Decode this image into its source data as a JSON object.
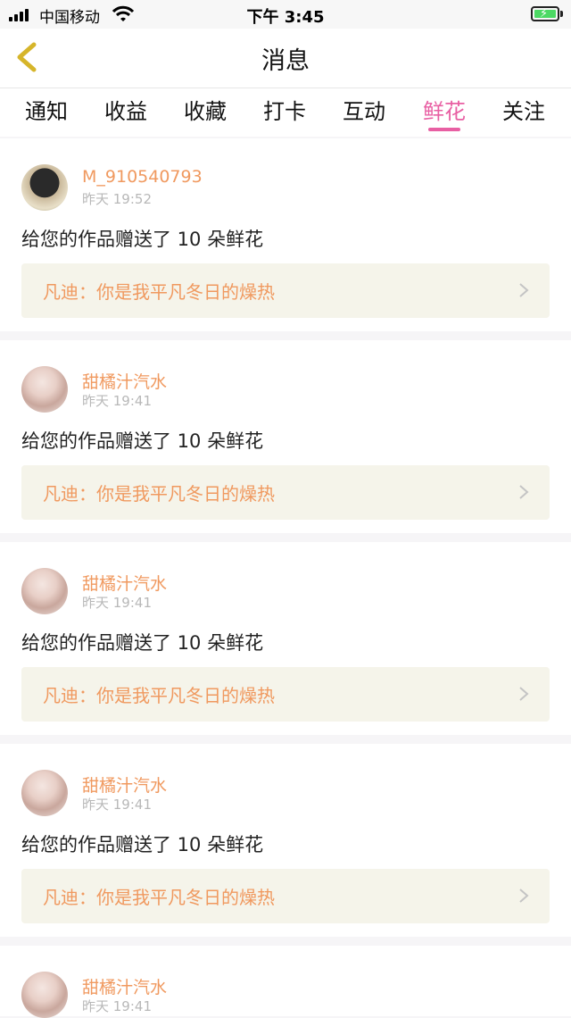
{
  "status_bar": {
    "carrier": "中国移动",
    "time": "下午 3:45"
  },
  "header": {
    "title": "消息"
  },
  "tabs": [
    {
      "label": "通知"
    },
    {
      "label": "收益"
    },
    {
      "label": "收藏"
    },
    {
      "label": "打卡"
    },
    {
      "label": "互动"
    },
    {
      "label": "鲜花",
      "active": true
    },
    {
      "label": "关注"
    }
  ],
  "colors": {
    "accent_pink": "#e85fa3",
    "accent_orange": "#f0995f",
    "work_bg": "#f5f4ea"
  },
  "notifications": [
    {
      "user": "M_910540793",
      "time": "昨天 19:52",
      "message": "给您的作品赠送了 10 朵鲜花",
      "work": "凡迪：你是我平凡冬日的燥热"
    },
    {
      "user": "甜橘汁汽水",
      "time": "昨天 19:41",
      "message": "给您的作品赠送了 10 朵鲜花",
      "work": "凡迪：你是我平凡冬日的燥热"
    },
    {
      "user": "甜橘汁汽水",
      "time": "昨天 19:41",
      "message": "给您的作品赠送了 10 朵鲜花",
      "work": "凡迪：你是我平凡冬日的燥热"
    },
    {
      "user": "甜橘汁汽水",
      "time": "昨天 19:41",
      "message": "给您的作品赠送了 10 朵鲜花",
      "work": "凡迪：你是我平凡冬日的燥热"
    },
    {
      "user": "甜橘汁汽水",
      "time": "昨天 19:41"
    }
  ]
}
